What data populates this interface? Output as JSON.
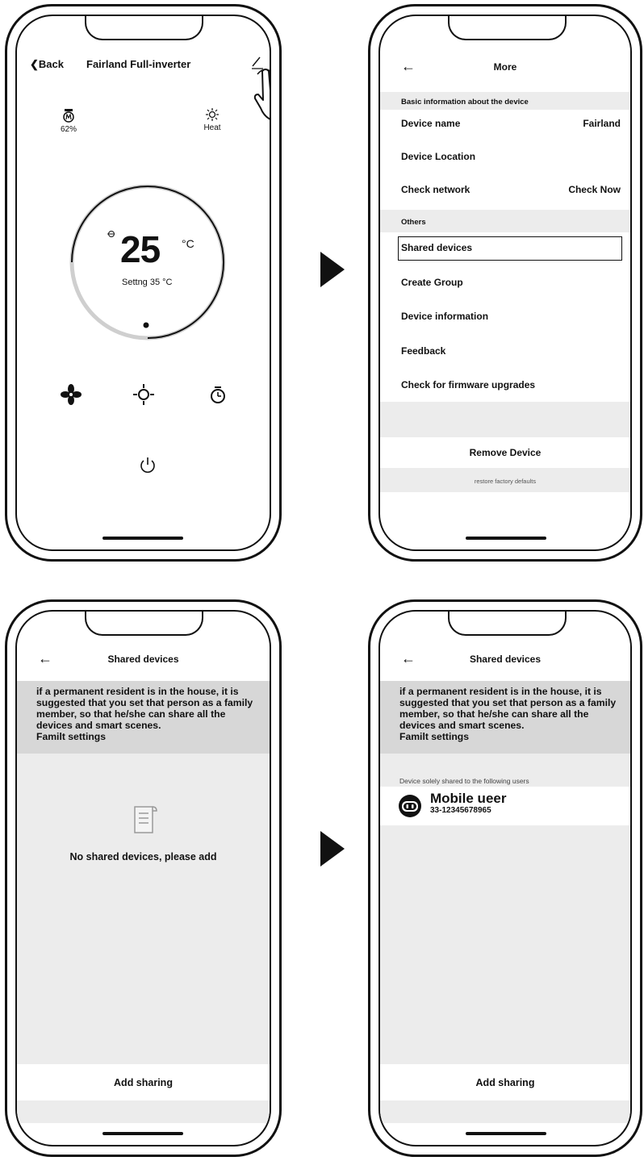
{
  "screen1": {
    "back_label": "Back",
    "title": "Fairland Full-inverter",
    "mode_left_value": "62%",
    "mode_right_label": "Heat",
    "temperature": "25",
    "temp_unit": "°C",
    "setting_text": "Settng 35 °C",
    "icons": [
      "edit-icon",
      "tap-hand-icon",
      "speed-icon",
      "sun-icon",
      "fan-icon",
      "heat-icon",
      "timer-icon",
      "power-icon"
    ]
  },
  "screen2": {
    "title": "More",
    "section_basic": "Basic information about the device",
    "device_name_label": "Device name",
    "device_name_value": "Fairland",
    "device_location_label": "Device Location",
    "check_network_label": "Check network",
    "check_network_value": "Check Now",
    "section_others": "Others",
    "shared_devices": "Shared devices",
    "create_group": "Create Group",
    "device_information": "Device information",
    "feedback": "Feedback",
    "firmware": "Check for firmware upgrades",
    "remove_device": "Remove Device",
    "restore_defaults": "restore factory defaults"
  },
  "screen3": {
    "title": "Shared devices",
    "info_text": "if a permanent resident is in the house, it is suggested that you set that person as a family member, so that he/she can share all the devices and smart scenes.",
    "info_link": "Familt settings",
    "empty_text": "No shared devices, please add",
    "add_sharing": "Add sharing"
  },
  "screen4": {
    "title": "Shared devices",
    "info_text": "if a permanent resident is in the house, it is suggested that you set that person as a family member, so that he/she can share all the devices and smart scenes.",
    "info_link": "Familt settings",
    "shared_label": "Device solely shared to the following users",
    "user_name": "Mobile ueer",
    "user_id": "33-12345678965",
    "add_sharing": "Add sharing"
  },
  "colors": {
    "section_gray": "#ececec",
    "info_gray": "#d7d7d7",
    "ink": "#111111"
  }
}
